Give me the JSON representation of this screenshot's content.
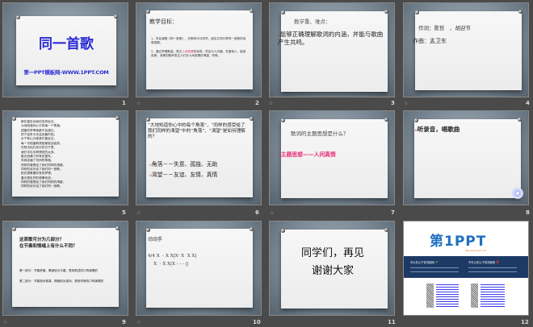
{
  "slides": [
    {
      "num": "1",
      "title": "同一首歌",
      "subtitle": "第一PPT模板网-WWW.1PPT.COM"
    },
    {
      "num": "2",
      "heading": "教学目标：",
      "item1": "1、学会演唱《同一首歌》，在歌声中与同学、朋友共同分享同一首歌的真挚感情。",
      "item2a": "2、通过学唱歌曲，表达",
      "item2hl": "人间真情",
      "item2b": "的追求。学会与人沟通、关爱他人，能用真挚、深情的歌声表达人们对人间真情的渴望、呼唤。"
    },
    {
      "num": "3",
      "heading": "教学重、难点：",
      "body": "能够正确理解歌词的内涵，并能与歌曲产生共鸣。"
    },
    {
      "num": "4",
      "line1": "作词：陈哲　、胡迎节",
      "line2": "作曲：孟卫东"
    },
    {
      "num": "5",
      "lyrics": [
        "鲜花曾告诉我你怎样走过，",
        "大地知道你心中的每一个角落，",
        "甜蜜的梦啊谁都不会错过，",
        "终于迎来今天这欢聚时刻。",
        "水千条山万座我们曾走过，",
        "每一次相逢和笑脸都彼此铭刻，",
        "在阳光灿烂欢乐的日子里，",
        "我们手拉手啊想说的太多。",
        "星光洒满了所有的童年，",
        "风雨走遍了世间的角落，",
        "同样的感受给了我们同样的渴望，",
        "同样的欢乐给了我们同一首歌。",
        "阳光想象着所有的梦想，",
        "春天把友好的故事传说，",
        "同样的感受给了我们同样的渴望，",
        "同样的欢乐给了我们同一首歌。"
      ]
    },
    {
      "num": "6",
      "question": "“大地知道你心中的每个角落”，“同样的感受给了我们同样的渴望”中的“角落”、“渴望”是如何理解的？",
      "a1": "角落－－失意、孤独、无助",
      "a2": "渴望－－友谊、友情、真情"
    },
    {
      "num": "7",
      "question": "歌词的主题思想是什么？",
      "answer": "主题思想——人间真情"
    },
    {
      "num": "8",
      "body": "听录音，唱歌曲"
    },
    {
      "num": "9",
      "q1": "这首歌可分为几部分？",
      "q2": "在节奏和情绪上有什么不同？",
      "p1": "第一部分：节奏舒缓，情绪较为平缓，是用叙述的口吻演唱的",
      "p2": "第二部分：节奏相对紧凑，情绪较为激动，是用呼唤的口吻演唱的"
    },
    {
      "num": "10",
      "heading": "动动手",
      "row1": "4/4 X  - X X|X· X  X X|",
      "row2": "    X  - X X|X - - - ||"
    },
    {
      "num": "11",
      "line1": "同学们，再见",
      "line2": "谢谢大家"
    },
    {
      "num": "12",
      "logo": "第1PPT",
      "url": "http://www.1ppt.com",
      "can": "可以在以下情况使用",
      "cannot": "不可以在以下情况使用",
      "check": "✔",
      "cross": "✘"
    }
  ],
  "star": "☆",
  "colors": {
    "accent": "#e8337a",
    "title_blue": "#2b2bd6",
    "banner": "#1d3a66"
  }
}
